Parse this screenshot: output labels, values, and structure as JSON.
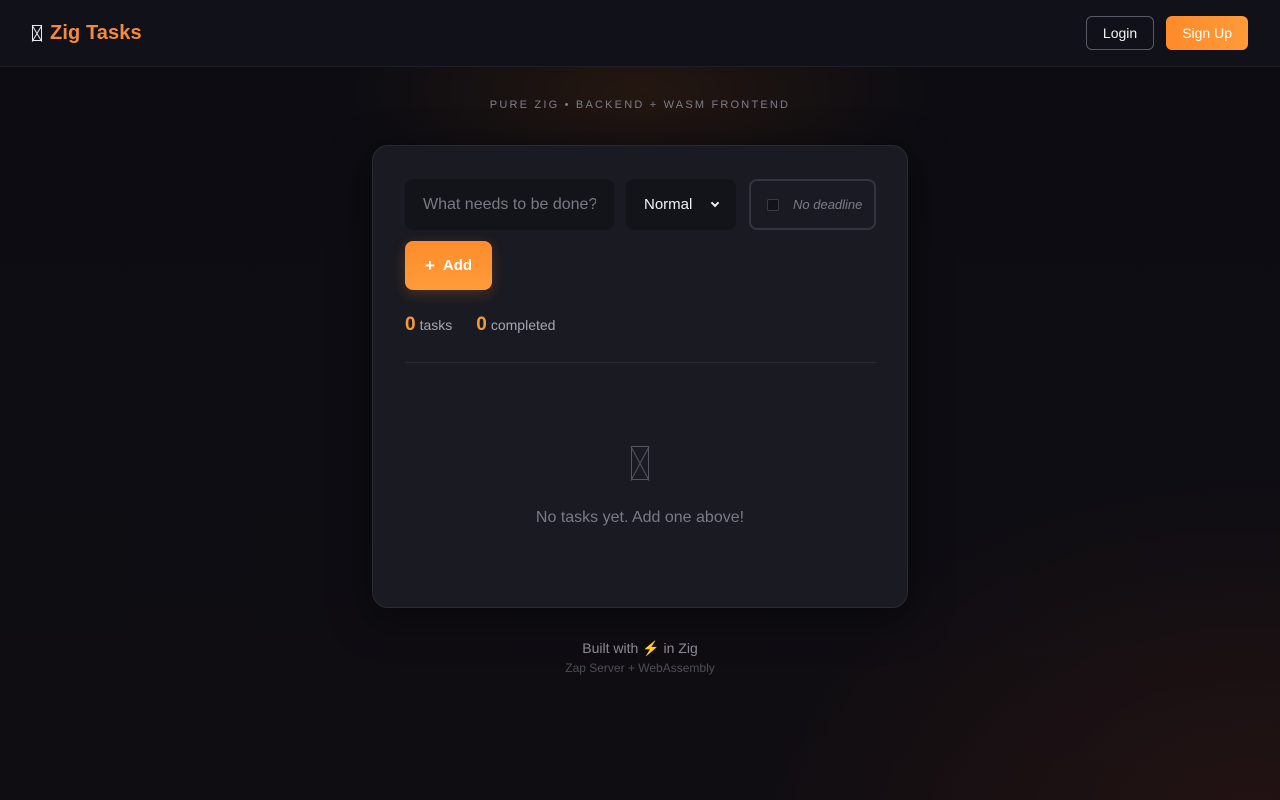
{
  "header": {
    "logo_icon": "missing-glyph-icon",
    "title": "Zig Tasks",
    "login_label": "Login",
    "signup_label": "Sign Up"
  },
  "tagline": "PURE ZIG • BACKEND + WASM FRONTEND",
  "form": {
    "task_placeholder": "What needs to be done?",
    "task_value": "",
    "priority": "Normal",
    "deadline_label": "No deadline",
    "add_label": "Add",
    "add_icon": "+"
  },
  "stats": {
    "tasks_count": "0",
    "tasks_label": "tasks",
    "completed_count": "0",
    "completed_label": "completed"
  },
  "empty_state": {
    "icon": "missing-glyph-icon",
    "message": "No tasks yet. Add one above!"
  },
  "footer": {
    "built_prefix": "Built with",
    "bolt": "⚡",
    "built_suffix": "in Zig",
    "sub": "Zap Server + WebAssembly"
  },
  "colors": {
    "accent": "#ff8c2c",
    "brand": "#f58a3a",
    "background": "#0d0d13",
    "card": "#1a1a22"
  }
}
